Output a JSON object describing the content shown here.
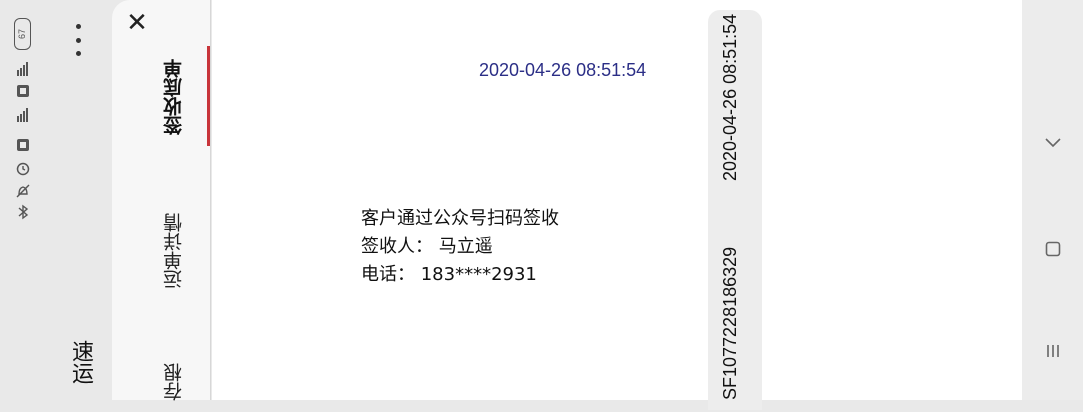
{
  "status_bar": {
    "battery": "67",
    "icons": [
      "signal-4g-icon",
      "hd-icon",
      "signal-4g-icon",
      "hd-icon",
      "alarm-icon",
      "silent-icon",
      "bluetooth-icon"
    ]
  },
  "app": {
    "name": "速运"
  },
  "tabs": [
    {
      "label": "签收底单",
      "active": true
    },
    {
      "label": "运单详情",
      "active": false
    },
    {
      "label": "存根",
      "active": false
    }
  ],
  "receipt": {
    "time": "2020-04-26 08:51:54",
    "method": "客户通过公众号扫码签收",
    "signer_line": "签收人： 马立遥",
    "phone_line": "电话： 183****2931",
    "side_time": "2020-04-26 08:51:54",
    "waybill_no": "SF1077228186329"
  },
  "colors": {
    "accent": "#c8343a",
    "time_text": "#2b2e86"
  }
}
